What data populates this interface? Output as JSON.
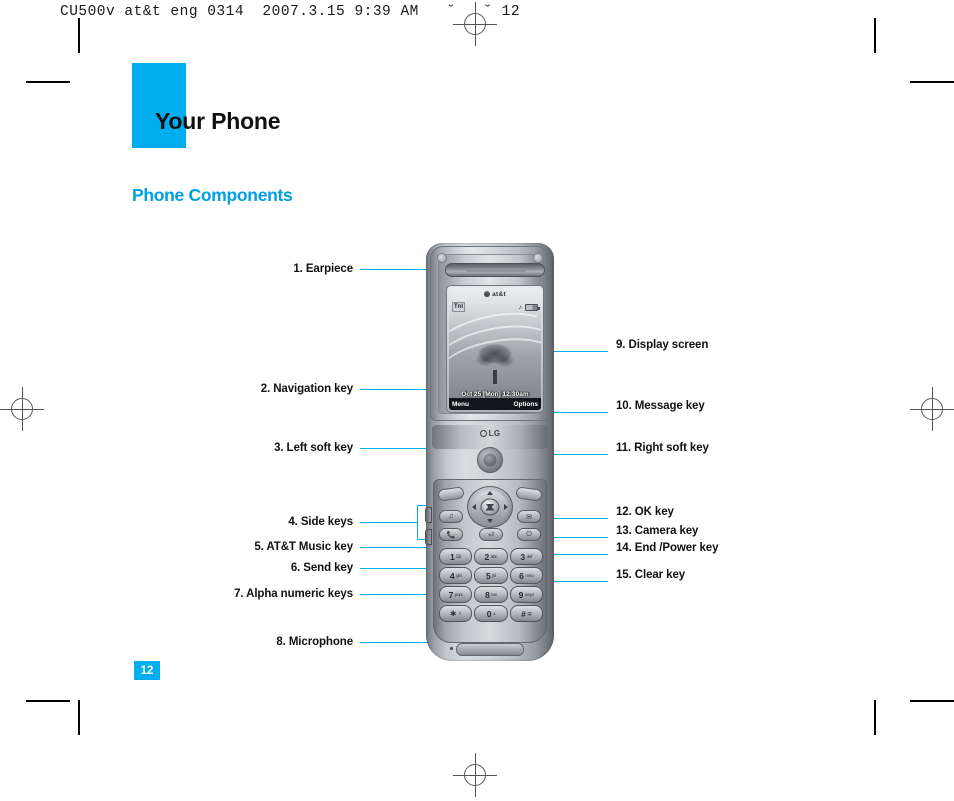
{
  "print_slug": "CU500v at&t eng 0314  2007.3.15 9:39 AM   ˘   ˘ 12",
  "chapter": {
    "title": "Your Phone"
  },
  "section": {
    "title": "Phone Components"
  },
  "page_number": "12",
  "colors": {
    "accent_cyan": "#00AEEF",
    "section_blue": "#00A0E3",
    "text_black": "#111111"
  },
  "callouts_left": [
    {
      "id": 1,
      "label": "1. Earpiece"
    },
    {
      "id": 2,
      "label": "2. Navigation key"
    },
    {
      "id": 3,
      "label": "3. Left soft key"
    },
    {
      "id": 4,
      "label": "4. Side keys"
    },
    {
      "id": 5,
      "label": "5. AT&T Music key"
    },
    {
      "id": 6,
      "label": "6. Send key"
    },
    {
      "id": 7,
      "label": "7. Alpha numeric keys"
    },
    {
      "id": 8,
      "label": "8. Microphone"
    }
  ],
  "callouts_right": [
    {
      "id": 9,
      "label": "9. Display screen"
    },
    {
      "id": 10,
      "label": "10. Message key"
    },
    {
      "id": 11,
      "label": "11. Right soft key"
    },
    {
      "id": 12,
      "label": "12. OK key"
    },
    {
      "id": 13,
      "label": "13. Camera key"
    },
    {
      "id": 14,
      "label": "14. End /Power key"
    },
    {
      "id": 15,
      "label": "15. Clear key"
    }
  ],
  "phone": {
    "brand": "LG",
    "carrier": "at&t",
    "screen": {
      "signal": "Tnl",
      "date_time": "Oct 25 [Mon] 12:30am",
      "left_soft": "Menu",
      "right_soft": "Options"
    },
    "keys": [
      {
        "big": "1",
        "sml": "⌧"
      },
      {
        "big": "2",
        "sml": "abc"
      },
      {
        "big": "3",
        "sml": "def"
      },
      {
        "big": "4",
        "sml": "ghi"
      },
      {
        "big": "5",
        "sml": "jkl"
      },
      {
        "big": "6",
        "sml": "mno"
      },
      {
        "big": "7",
        "sml": "pqrs"
      },
      {
        "big": "8",
        "sml": "tuv"
      },
      {
        "big": "9",
        "sml": "wxyz"
      },
      {
        "big": "∗",
        "sml": "⇧"
      },
      {
        "big": "0",
        "sml": "±"
      },
      {
        "big": "#",
        "sml": "▤"
      }
    ]
  }
}
